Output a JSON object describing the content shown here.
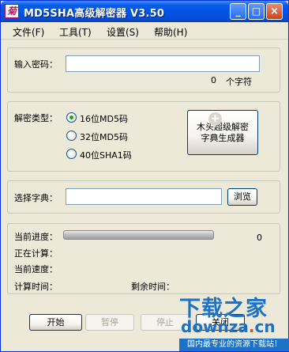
{
  "window": {
    "title": "MD5SHA高级解密器 V3.50",
    "icon_letter": "菊",
    "controls": {
      "minimize": "_",
      "maximize": "□",
      "close": "×"
    }
  },
  "menu": [
    "文件(F)",
    "工具(T)",
    "设置(S)",
    "帮助(H)"
  ],
  "password": {
    "label": "输入密码：",
    "value": "",
    "char_count": "0",
    "char_unit": "个字符"
  },
  "decrypt_type": {
    "label": "解密类型：",
    "options": [
      "16位MD5码",
      "32位MD5码",
      "40位SHA1码"
    ],
    "selected_index": 0,
    "dict_generator_line1": "木头超级解密",
    "dict_generator_line2": "字典生成器"
  },
  "dictionary": {
    "label": "选择字典：",
    "value": "",
    "browse_label": "浏览"
  },
  "status": {
    "progress_label": "当前进度：",
    "progress_value": "0",
    "progress_fraction": 0,
    "computing_label": "正在计算：",
    "speed_label": "当前速度：",
    "time_label": "计算时间：",
    "remaining_label": "剩余时间："
  },
  "actions": {
    "start": "开始",
    "pause": "暂停",
    "stop": "停止",
    "close": "关闭"
  },
  "watermark": {
    "brand": "下载之家",
    "url_prefix": "downza",
    "url_dot": ".",
    "url_suffix": "cn",
    "tagline": "国内最专业的资源下载站！"
  },
  "colors": {
    "title_blue": "#0054e3",
    "watermark_blue": "#1b72c8",
    "radio_green": "#21a121"
  }
}
